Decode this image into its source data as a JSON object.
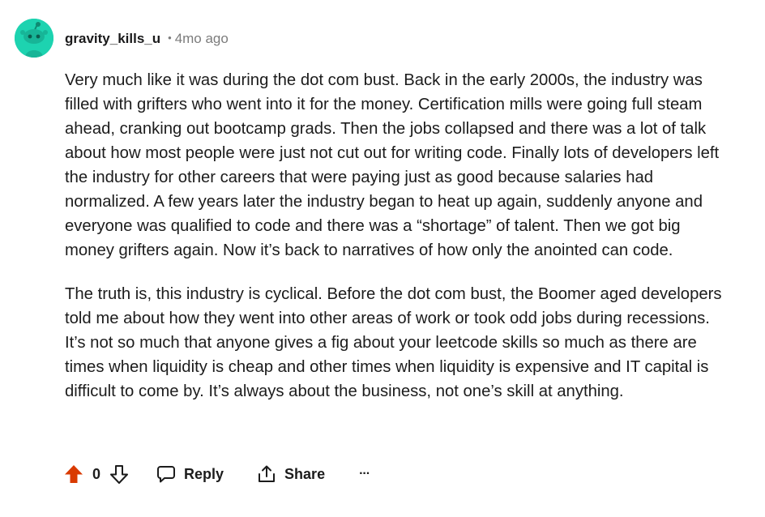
{
  "comment": {
    "author": "gravity_kills_u",
    "separator": "•",
    "timestamp": "4mo ago",
    "paragraphs": [
      "Very much like it was during the dot com bust. Back in the early 2000s, the industry was filled with grifters who went into it for the money. Certification mills were going full steam ahead, cranking out bootcamp grads. Then the jobs collapsed and there was a lot of talk about how most people were just not cut out for writing code. Finally lots of developers left the industry for other careers that were paying just as good because salaries had normalized. A few years later the industry began to heat up again, suddenly anyone and everyone was qualified to code and there was a “shortage” of talent. Then we got big money grifters again. Now it’s back to narratives of how only the anointed can code.",
      "The truth is, this industry is cyclical. Before the dot com bust, the Boomer aged developers told me about how they went into other areas of work or took odd jobs during recessions. It’s not so much that anyone gives a fig about your leetcode skills so much as there are times when liquidity is cheap and other times when liquidity is expensive and IT capital is difficult to come by. It’s always about the business, not one’s skill at anything."
    ]
  },
  "actions": {
    "vote_count": "0",
    "reply_label": "Reply",
    "share_label": "Share",
    "more_label": "···"
  },
  "colors": {
    "avatar_bg": "#1dd3b0",
    "upvote_active": "#d93a00",
    "text": "#1c1c1c",
    "meta_gray": "#7c7c7c"
  },
  "icons": {
    "avatar": "snoo-avatar-icon",
    "upvote": "upvote-arrow-icon",
    "downvote": "downvote-arrow-icon",
    "reply": "chat-bubble-icon",
    "share": "share-icon",
    "more": "ellipsis-icon"
  }
}
